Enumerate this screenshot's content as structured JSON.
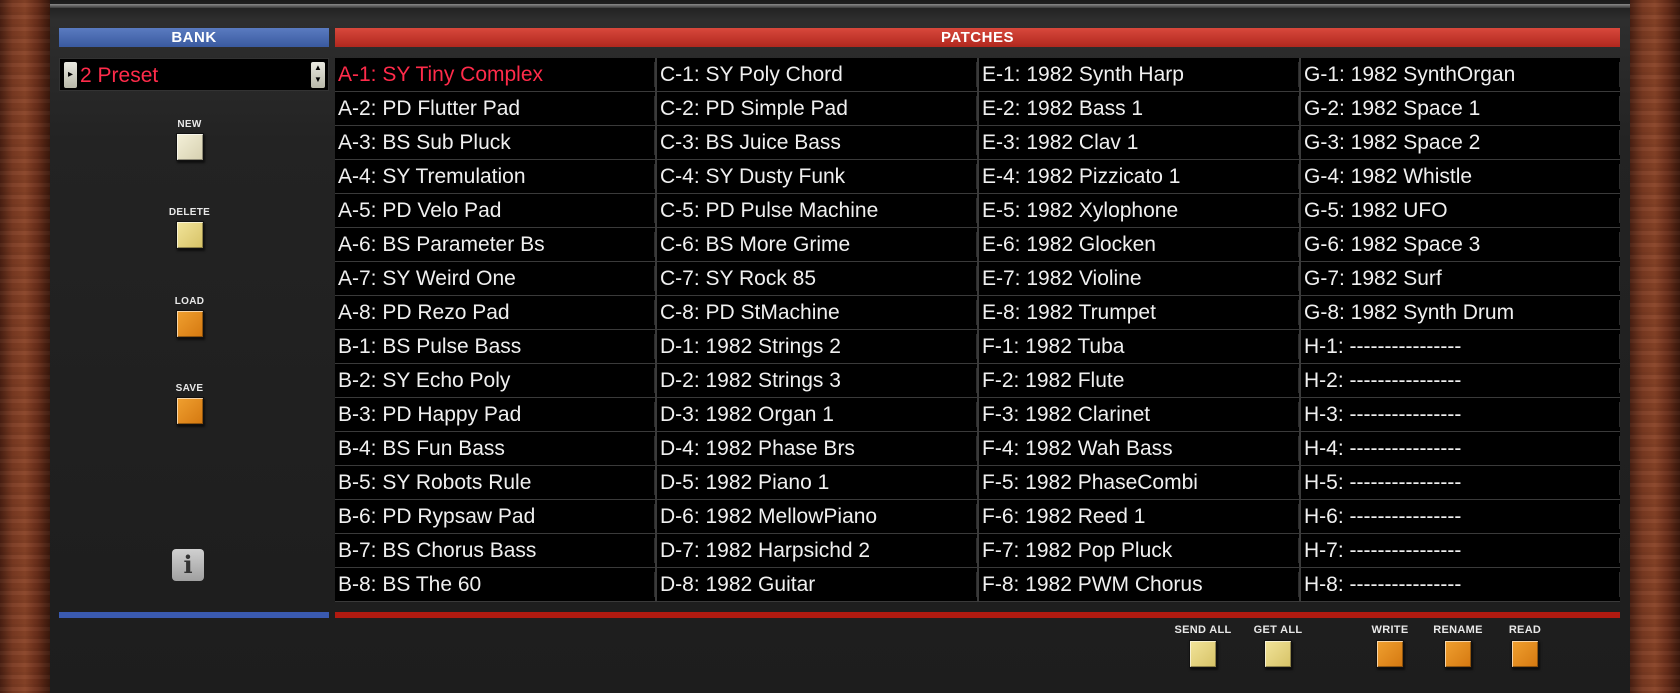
{
  "headers": {
    "bank": "BANK",
    "patches": "PATCHES"
  },
  "bank_select": {
    "value": "2 Preset"
  },
  "side_buttons": [
    {
      "label": "NEW",
      "color": "#e8e2c4"
    },
    {
      "label": "DELETE",
      "color": "#e8d880"
    },
    {
      "label": "LOAD",
      "color": "#e48c20"
    },
    {
      "label": "SAVE",
      "color": "#e48c20"
    }
  ],
  "info_icon": "info-icon",
  "selected_patch": "A-1: SY Tiny Complex",
  "columns": [
    [
      "A-1: SY Tiny Complex",
      "A-2: PD Flutter Pad",
      "A-3: BS Sub Pluck",
      "A-4: SY Tremulation",
      "A-5: PD Velo Pad",
      "A-6: BS Parameter Bs",
      "A-7: SY Weird One",
      "A-8: PD Rezo Pad",
      "B-1: BS Pulse Bass",
      "B-2: SY Echo Poly",
      "B-3: PD Happy Pad",
      "B-4: BS Fun Bass",
      "B-5: SY Robots Rule",
      "B-6: PD Rypsaw Pad",
      "B-7: BS Chorus Bass",
      "B-8: BS The 60"
    ],
    [
      "C-1: SY Poly Chord",
      "C-2: PD Simple Pad",
      "C-3: BS Juice Bass",
      "C-4: SY Dusty Funk",
      "C-5: PD Pulse Machine",
      "C-6: BS More Grime",
      "C-7: SY Rock 85",
      "C-8: PD StMachine",
      "D-1: 1982 Strings 2",
      "D-2: 1982 Strings 3",
      "D-3: 1982 Organ 1",
      "D-4: 1982 Phase Brs",
      "D-5: 1982 Piano 1",
      "D-6: 1982 MellowPiano",
      "D-7: 1982 Harpsichd 2",
      "D-8: 1982 Guitar"
    ],
    [
      "E-1: 1982 Synth Harp",
      "E-2: 1982 Bass 1",
      "E-3: 1982 Clav 1",
      "E-4: 1982 Pizzicato 1",
      "E-5: 1982 Xylophone",
      "E-6: 1982 Glocken",
      "E-7: 1982 Violine",
      "E-8: 1982 Trumpet",
      "F-1: 1982 Tuba",
      "F-2: 1982 Flute",
      "F-3: 1982 Clarinet",
      "F-4: 1982 Wah Bass",
      "F-5: 1982 PhaseCombi",
      "F-6: 1982 Reed 1",
      "F-7: 1982 Pop Pluck",
      "F-8: 1982 PWM Chorus"
    ],
    [
      "G-1: 1982 SynthOrgan",
      "G-2: 1982 Space 1",
      "G-3: 1982 Space 2",
      "G-4: 1982 Whistle",
      "G-5: 1982 UFO",
      "G-6: 1982 Space 3",
      "G-7: 1982 Surf",
      "G-8: 1982 Synth Drum",
      "H-1: ----------------",
      "H-2: ----------------",
      "H-3: ----------------",
      "H-4: ----------------",
      "H-5: ----------------",
      "H-6: ----------------",
      "H-7: ----------------",
      "H-8: ----------------"
    ]
  ],
  "bottom_buttons": [
    {
      "label": "SEND ALL",
      "color": "#e8d880"
    },
    {
      "label": "GET ALL",
      "color": "#e8d880"
    },
    {
      "label": "WRITE",
      "color": "#e48c20"
    },
    {
      "label": "RENAME",
      "color": "#e48c20"
    },
    {
      "label": "READ",
      "color": "#e48c20"
    }
  ],
  "colors": {
    "bank_blue": "#4a6ab0",
    "patches_red": "#c0302a",
    "selected_text": "#ff2b4a"
  }
}
